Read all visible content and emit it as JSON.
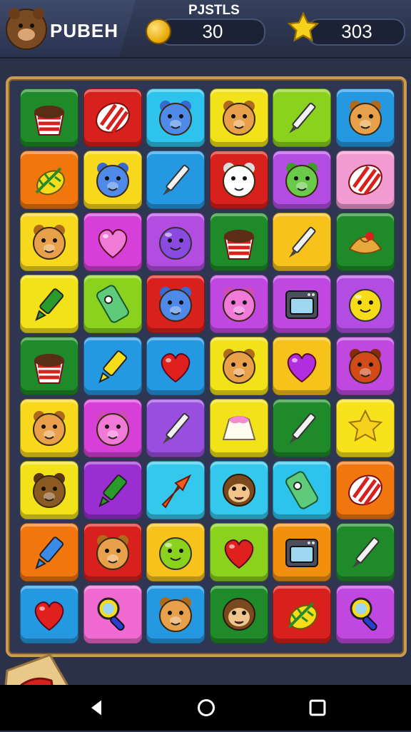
{
  "header": {
    "player_name": "PUBEH",
    "scores_title": "PJSTLS",
    "coins": "30",
    "stars": "303",
    "avatar_icon": "bear-face-icon",
    "coin_icon": "gold-coin-icon",
    "star_icon": "star-icon"
  },
  "board": {
    "columns": 6,
    "rows": 9,
    "tiles": [
      {
        "bg": "#1f8a2a",
        "icon": "pudding-cup"
      },
      {
        "bg": "#d8201c",
        "icon": "striped-candy"
      },
      {
        "bg": "#2ec3ec",
        "icon": "blue-bear"
      },
      {
        "bg": "#f2e21a",
        "icon": "lion"
      },
      {
        "bg": "#8bd21e",
        "icon": "pencil"
      },
      {
        "bg": "#2598e2",
        "icon": "lion"
      },
      {
        "bg": "#f2760e",
        "icon": "leaf-lemon"
      },
      {
        "bg": "#f7d81c",
        "icon": "blue-bear"
      },
      {
        "bg": "#2598e2",
        "icon": "pencil"
      },
      {
        "bg": "#d8201c",
        "icon": "white-bear"
      },
      {
        "bg": "#b34de2",
        "icon": "green-bear"
      },
      {
        "bg": "#f29ad2",
        "icon": "striped-candy"
      },
      {
        "bg": "#f7d81c",
        "icon": "lion"
      },
      {
        "bg": "#d640d8",
        "icon": "heart-pink"
      },
      {
        "bg": "#b34de2",
        "icon": "purple-blob"
      },
      {
        "bg": "#1f8a2a",
        "icon": "pudding-cup"
      },
      {
        "bg": "#f7c21c",
        "icon": "pencil"
      },
      {
        "bg": "#1f8a2a",
        "icon": "croissant"
      },
      {
        "bg": "#f2e21a",
        "icon": "green-crayon"
      },
      {
        "bg": "#8bd21e",
        "icon": "phone-gadget"
      },
      {
        "bg": "#d8201c",
        "icon": "blue-bear"
      },
      {
        "bg": "#c048e0",
        "icon": "pink-bear"
      },
      {
        "bg": "#c048e0",
        "icon": "oven"
      },
      {
        "bg": "#b34de2",
        "icon": "yellow-blob"
      },
      {
        "bg": "#1f8a2a",
        "icon": "pudding-cup"
      },
      {
        "bg": "#2598e2",
        "icon": "yellow-crayon"
      },
      {
        "bg": "#2598e2",
        "icon": "heart-red"
      },
      {
        "bg": "#f2e21a",
        "icon": "lion"
      },
      {
        "bg": "#f7c21c",
        "icon": "heart-purple"
      },
      {
        "bg": "#c048e0",
        "icon": "red-bear"
      },
      {
        "bg": "#f7d81c",
        "icon": "lion"
      },
      {
        "bg": "#d640d8",
        "icon": "pink-bear"
      },
      {
        "bg": "#9a4ee0",
        "icon": "pencil"
      },
      {
        "bg": "#f2e21a",
        "icon": "cake-slice"
      },
      {
        "bg": "#1f8a2a",
        "icon": "pencil"
      },
      {
        "bg": "#f7e21c",
        "icon": "star"
      },
      {
        "bg": "#f2e21a",
        "icon": "brown-bear"
      },
      {
        "bg": "#9a2ed0",
        "icon": "green-crayon"
      },
      {
        "bg": "#33c8ec",
        "icon": "arrow-up"
      },
      {
        "bg": "#33c8ec",
        "icon": "monkey"
      },
      {
        "bg": "#2ec3ec",
        "icon": "phone-gadget"
      },
      {
        "bg": "#f2760e",
        "icon": "striped-candy"
      },
      {
        "bg": "#f2760e",
        "icon": "blue-crayon"
      },
      {
        "bg": "#d8201c",
        "icon": "lion"
      },
      {
        "bg": "#f7c21c",
        "icon": "lime-blob"
      },
      {
        "bg": "#8bd21e",
        "icon": "heart-red"
      },
      {
        "bg": "#f2900e",
        "icon": "oven"
      },
      {
        "bg": "#1f8a2a",
        "icon": "pencil"
      },
      {
        "bg": "#2598e2",
        "icon": "heart-red"
      },
      {
        "bg": "#f06ad2",
        "icon": "magnifier"
      },
      {
        "bg": "#2598e2",
        "icon": "lion"
      },
      {
        "bg": "#1f8a2a",
        "icon": "monkey"
      },
      {
        "bg": "#d8201c",
        "icon": "leaf-lemon"
      },
      {
        "bg": "#c048e0",
        "icon": "magnifier"
      }
    ]
  },
  "booster": {
    "icon": "red-cross-shield-icon"
  },
  "navbar": {
    "back_icon": "back-triangle-icon",
    "home_icon": "home-circle-icon",
    "recents_icon": "recents-square-icon"
  }
}
